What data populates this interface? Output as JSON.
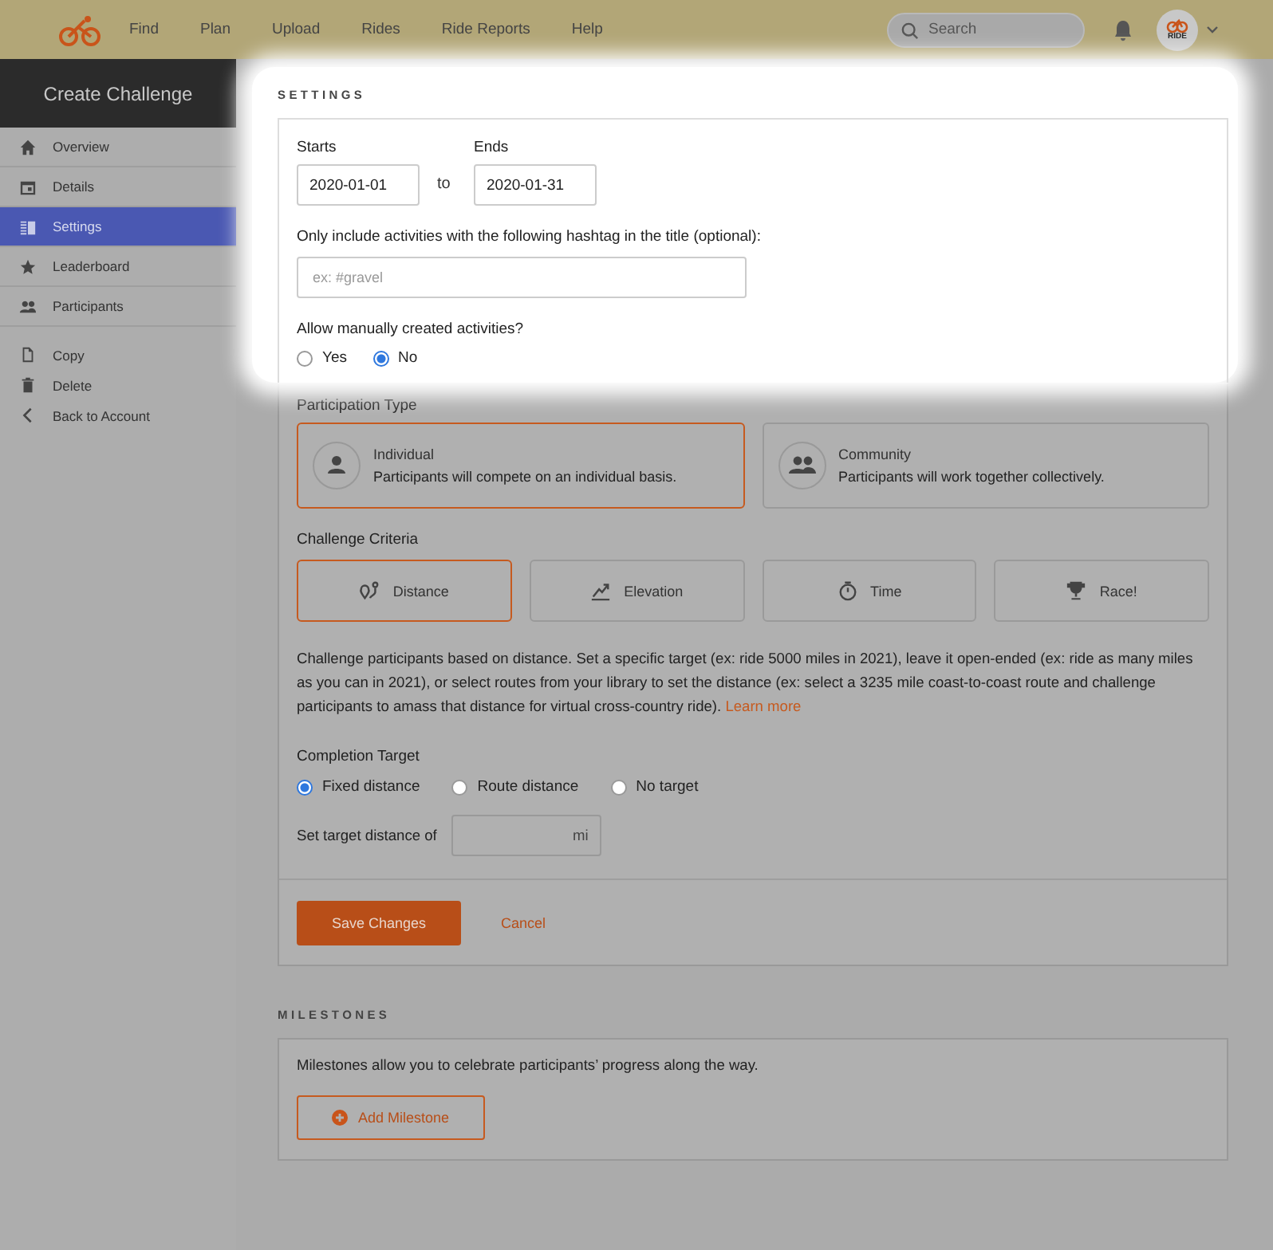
{
  "header": {
    "nav": [
      "Find",
      "Plan",
      "Upload",
      "Rides",
      "Ride Reports",
      "Help"
    ],
    "search": {
      "placeholder": "Search"
    },
    "avatar_label": "RIDE"
  },
  "sidebar": {
    "title": "Create Challenge",
    "items": [
      {
        "label": "Overview",
        "selected": false
      },
      {
        "label": "Details",
        "selected": false
      },
      {
        "label": "Settings",
        "selected": true
      },
      {
        "label": "Leaderboard",
        "selected": false
      },
      {
        "label": "Participants",
        "selected": false
      }
    ],
    "actions": [
      {
        "label": "Copy"
      },
      {
        "label": "Delete"
      },
      {
        "label": "Back to Account"
      }
    ]
  },
  "settings": {
    "heading": "SETTINGS",
    "starts": {
      "label": "Starts",
      "value": "2020-01-01"
    },
    "to": "to",
    "ends": {
      "label": "Ends",
      "value": "2020-01-31"
    },
    "hashtag": {
      "label": "Only include activities with the following hashtag in the title (optional):",
      "placeholder": "ex: #gravel"
    },
    "manual": {
      "label": "Allow manually created activities?",
      "options": [
        {
          "label": "Yes",
          "selected": false
        },
        {
          "label": "No",
          "selected": true
        }
      ]
    },
    "participation": {
      "label": "Participation Type",
      "options": [
        {
          "title": "Individual",
          "text": "Participants will compete on an individual basis.",
          "selected": true
        },
        {
          "title": "Community",
          "text": "Participants will work together collectively.",
          "selected": false
        }
      ]
    },
    "criteria": {
      "label": "Challenge Criteria",
      "options": [
        {
          "label": "Distance",
          "selected": true
        },
        {
          "label": "Elevation",
          "selected": false
        },
        {
          "label": "Time",
          "selected": false
        },
        {
          "label": "Race!",
          "selected": false
        }
      ]
    },
    "description": "Challenge participants based on distance. Set a specific target (ex: ride 5000 miles in 2021), leave it open-ended (ex: ride as many miles as you can in 2021), or select routes from your library to set the distance (ex: select a 3235 mile coast-to-coast route and challenge participants to amass that distance for virtual cross-country ride).",
    "learn_more": "Learn more",
    "completion": {
      "label": "Completion Target",
      "options": [
        {
          "label": "Fixed distance",
          "selected": true
        },
        {
          "label": "Route distance",
          "selected": false
        },
        {
          "label": "No target",
          "selected": false
        }
      ]
    },
    "target": {
      "label": "Set target distance of",
      "unit": "mi"
    },
    "save": "Save Changes",
    "cancel": "Cancel"
  },
  "milestones": {
    "heading": "MILESTONES",
    "text": "Milestones allow you to celebrate participants’ progress along the way.",
    "button": "Add Milestone"
  }
}
